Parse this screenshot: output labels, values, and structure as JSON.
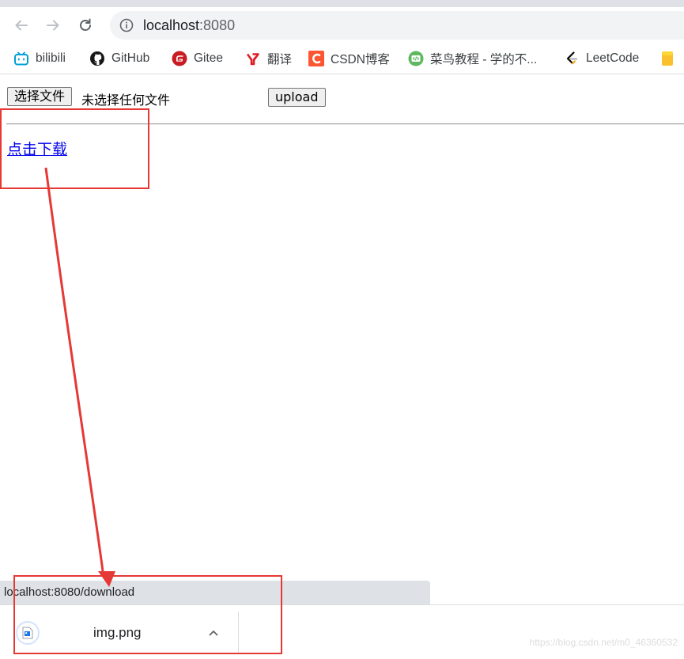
{
  "browser": {
    "url_host": "localhost",
    "url_port": ":8080",
    "bookmarks": [
      {
        "label": "bilibili",
        "icon": "bilibili-icon",
        "color": "#00a1d6"
      },
      {
        "label": "GitHub",
        "icon": "github-icon",
        "color": "#181717"
      },
      {
        "label": "Gitee",
        "icon": "gitee-icon",
        "color": "#c71d23"
      },
      {
        "label": "翻译",
        "icon": "youdao-icon",
        "color": "#e01e26"
      },
      {
        "label": "CSDN博客",
        "icon": "csdn-icon",
        "color": "#fc5531"
      },
      {
        "label": "菜鸟教程 - 学的不...",
        "icon": "runoob-icon",
        "color": "#5fb85f"
      },
      {
        "label": "LeetCode",
        "icon": "leetcode-icon",
        "color": "#ffa116"
      }
    ]
  },
  "page": {
    "choose_file_label": "选择文件",
    "no_file_text": "未选择任何文件",
    "upload_label": "upload",
    "download_link": "点击下载"
  },
  "status_bar": {
    "url": "localhost:8080/download"
  },
  "download_shelf": {
    "file_name": "img.png",
    "watermark": "https://blog.csdn.net/m0_46360532"
  },
  "colors": {
    "annotation": "#e53935",
    "link": "#0000ee"
  }
}
